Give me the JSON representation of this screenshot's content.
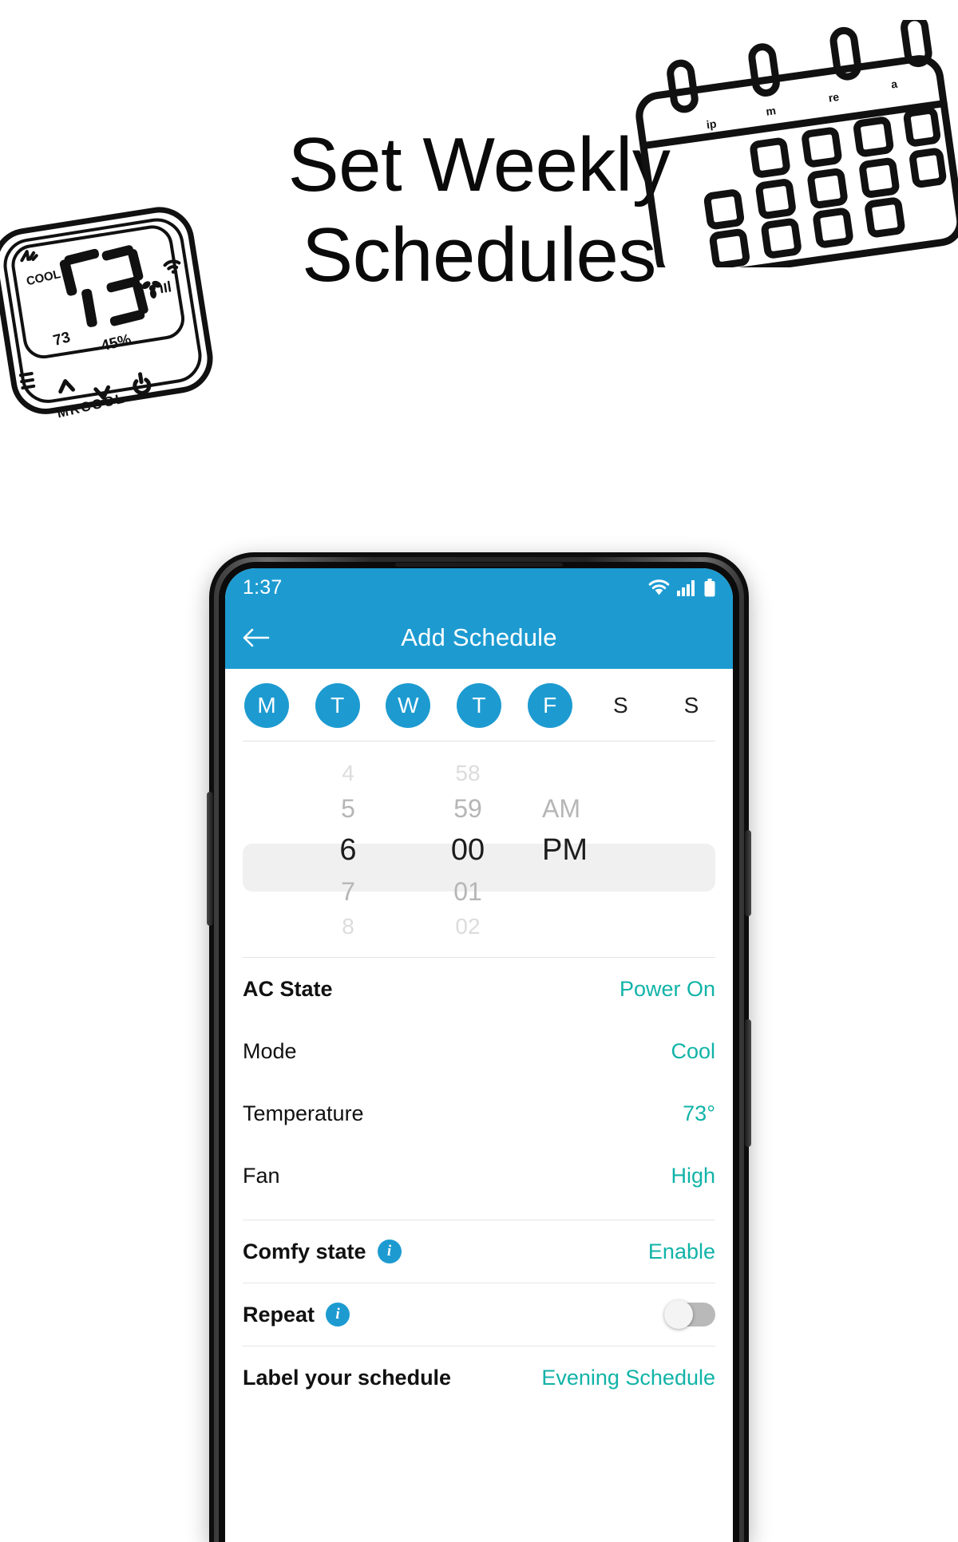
{
  "hero": {
    "title_line1": "Set Weekly",
    "title_line2": "Schedules"
  },
  "thermostat_art": {
    "name": "mrcool-thermostat-illustration",
    "mode_label": "COOL",
    "big_temp": "73",
    "small_temp": "73",
    "humidity": "45%",
    "brand": "MRCOOL"
  },
  "calendar_art": {
    "name": "calendar-illustration",
    "header_letters": [
      "ip",
      "m",
      "re",
      "a"
    ]
  },
  "phone": {
    "status_bar": {
      "time": "1:37",
      "icons": [
        "wifi-icon",
        "signal-icon",
        "battery-icon"
      ]
    },
    "app_bar": {
      "back_icon": "back-arrow-icon",
      "title": "Add Schedule"
    },
    "days": [
      {
        "label": "M",
        "selected": true
      },
      {
        "label": "T",
        "selected": true
      },
      {
        "label": "W",
        "selected": true
      },
      {
        "label": "T",
        "selected": true
      },
      {
        "label": "F",
        "selected": true
      },
      {
        "label": "S",
        "selected": false
      },
      {
        "label": "S",
        "selected": false
      }
    ],
    "time_picker": {
      "hours": [
        "4",
        "5",
        "6",
        "7",
        "8"
      ],
      "minutes": [
        "58",
        "59",
        "00",
        "01",
        "02"
      ],
      "meridiem": [
        "",
        "AM",
        "PM",
        "",
        ""
      ],
      "selected_hour": "6",
      "selected_minute": "00",
      "selected_meridiem": "PM"
    },
    "settings": [
      {
        "label": "AC State",
        "value": "Power On",
        "bold": true,
        "info": false,
        "type": "value"
      },
      {
        "label": "Mode",
        "value": "Cool",
        "bold": false,
        "info": false,
        "type": "value"
      },
      {
        "label": "Temperature",
        "value": "73°",
        "bold": false,
        "info": false,
        "type": "value"
      },
      {
        "label": "Fan",
        "value": "High",
        "bold": false,
        "info": false,
        "type": "value"
      },
      {
        "label": "Comfy state",
        "value": "Enable",
        "bold": true,
        "info": true,
        "type": "value"
      },
      {
        "label": "Repeat",
        "value": "",
        "bold": true,
        "info": true,
        "type": "toggle",
        "toggle_on": false
      },
      {
        "label": "Label your schedule",
        "value": "Evening Schedule",
        "bold": true,
        "info": false,
        "type": "value"
      }
    ]
  },
  "colors": {
    "brand_blue": "#1d9bd1",
    "teal_value": "#11b3a8",
    "text_dark": "#111111",
    "divider": "#e6e6e6"
  }
}
